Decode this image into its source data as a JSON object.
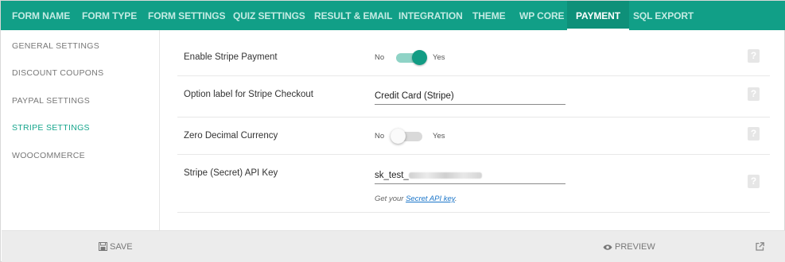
{
  "nav": {
    "tabs": [
      {
        "label": "FORM NAME"
      },
      {
        "label": "FORM TYPE"
      },
      {
        "label": "FORM SETTINGS"
      },
      {
        "label": "QUIZ SETTINGS"
      },
      {
        "label": "RESULT & EMAIL"
      },
      {
        "label": "INTEGRATION"
      },
      {
        "label": "THEME"
      },
      {
        "label": "WP CORE"
      },
      {
        "label": "PAYMENT"
      },
      {
        "label": "SQL EXPORT"
      }
    ],
    "active_tab": "PAYMENT"
  },
  "sidebar": {
    "items": [
      {
        "label": "GENERAL SETTINGS"
      },
      {
        "label": "DISCOUNT COUPONS"
      },
      {
        "label": "PAYPAL SETTINGS"
      },
      {
        "label": "STRIPE SETTINGS"
      },
      {
        "label": "WOOCOMMERCE"
      }
    ],
    "active_item": "STRIPE SETTINGS"
  },
  "settings": {
    "enable_stripe": {
      "label": "Enable Stripe Payment",
      "no": "No",
      "yes": "Yes",
      "state": "on"
    },
    "option_label": {
      "label": "Option label for Stripe Checkout",
      "value": "Credit Card (Stripe)"
    },
    "zero_decimal": {
      "label": "Zero Decimal Currency",
      "no": "No",
      "yes": "Yes",
      "state": "off"
    },
    "api_key": {
      "label": "Stripe (Secret) API Key",
      "value_prefix": "sk_test_",
      "hint_prefix": "Get your ",
      "hint_link": "Secret API key",
      "hint_suffix": "."
    },
    "help_glyph": "?"
  },
  "footer": {
    "save_label": "SAVE",
    "preview_label": "PREVIEW"
  },
  "colors": {
    "accent": "#119f87",
    "active_sidebar": "#17a68d"
  },
  "icons": {
    "save": "floppy-disk-icon",
    "preview": "eye-icon",
    "popout": "external-link-icon",
    "help": "question-mark-icon"
  }
}
